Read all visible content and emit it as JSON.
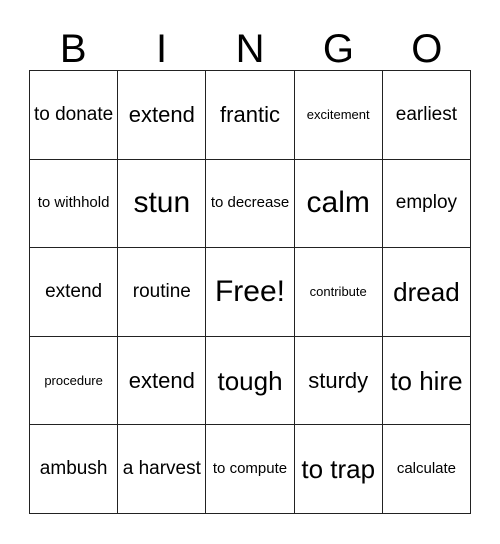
{
  "header": {
    "letters": [
      "B",
      "I",
      "N",
      "G",
      "O"
    ]
  },
  "grid": {
    "rows": [
      [
        {
          "text": "to donate",
          "size": "md"
        },
        {
          "text": "extend",
          "size": "lg"
        },
        {
          "text": "frantic",
          "size": "lg"
        },
        {
          "text": "excitement",
          "size": "xs"
        },
        {
          "text": "earliest",
          "size": "md"
        }
      ],
      [
        {
          "text": "to withhold",
          "size": "sm"
        },
        {
          "text": "stun",
          "size": "xxl"
        },
        {
          "text": "to decrease",
          "size": "sm"
        },
        {
          "text": "calm",
          "size": "xxl"
        },
        {
          "text": "employ",
          "size": "md"
        }
      ],
      [
        {
          "text": "extend",
          "size": "md"
        },
        {
          "text": "routine",
          "size": "md"
        },
        {
          "text": "Free!",
          "size": "xxl"
        },
        {
          "text": "contribute",
          "size": "xs"
        },
        {
          "text": "dread",
          "size": "xl"
        }
      ],
      [
        {
          "text": "procedure",
          "size": "xs"
        },
        {
          "text": "extend",
          "size": "lg"
        },
        {
          "text": "tough",
          "size": "xl"
        },
        {
          "text": "sturdy",
          "size": "lg"
        },
        {
          "text": "to hire",
          "size": "xl"
        }
      ],
      [
        {
          "text": "ambush",
          "size": "md"
        },
        {
          "text": "a harvest",
          "size": "md"
        },
        {
          "text": "to compute",
          "size": "sm"
        },
        {
          "text": "to trap",
          "size": "xl"
        },
        {
          "text": "calculate",
          "size": "sm"
        }
      ]
    ]
  },
  "colors": {
    "border": "#222222",
    "text": "#000000",
    "background": "#ffffff"
  }
}
